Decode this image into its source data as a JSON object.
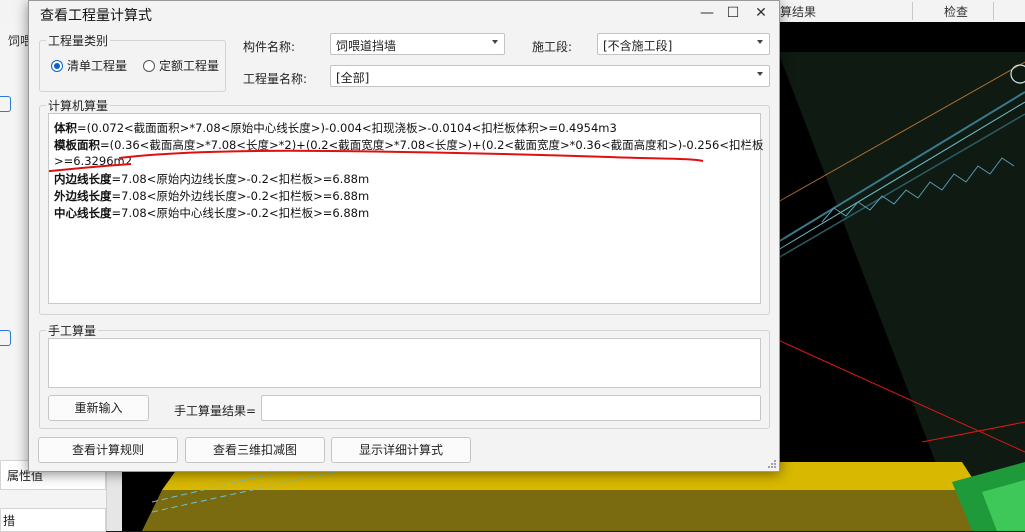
{
  "background_app": {
    "top_menu": [
      "算结果",
      "检查"
    ],
    "left_tab": "饲喂",
    "left_tab_short": "饲喂",
    "property_label": "属性值",
    "bottom_label": "措"
  },
  "dialog": {
    "title": "查看工程量计算式",
    "window_controls": {
      "minimize": "—",
      "maximize": "☐",
      "close": "✕"
    },
    "quantity_type": {
      "legend": "工程量类别",
      "options": [
        {
          "label": "清单工程量",
          "selected": true
        },
        {
          "label": "定额工程量",
          "selected": false
        }
      ]
    },
    "component_name": {
      "label": "构件名称:",
      "value": "饲喂道挡墙"
    },
    "construction_section": {
      "label": "施工段:",
      "value": "[不含施工段]"
    },
    "quantity_name": {
      "label": "工程量名称:",
      "value": "[全部]"
    },
    "computer_calc": {
      "legend": "计算机算量",
      "lines": [
        {
          "name": "体积",
          "expr": "=(0.072<截面面积>*7.08<原始中心线长度>)-0.004<扣现浇板>-0.0104<扣栏板体积>=0.4954m3"
        },
        {
          "name": "模板面积",
          "expr": "=(0.36<截面高度>*7.08<长度>*2)+(0.2<截面宽度>*7.08<长度>)+(0.2<截面宽度>*0.36<截面高度和>)-0.256<扣栏板"
        },
        {
          "name": "",
          "expr": ">=6.3296m2"
        },
        {
          "name": "内边线长度",
          "expr": "=7.08<原始内边线长度>-0.2<扣栏板>=6.88m"
        },
        {
          "name": "外边线长度",
          "expr": "=7.08<原始外边线长度>-0.2<扣栏板>=6.88m"
        },
        {
          "name": "中心线长度",
          "expr": "=7.08<原始中心线长度>-0.2<扣栏板>=6.88m"
        }
      ]
    },
    "manual_calc": {
      "legend": "手工算量",
      "reinput_button": "重新输入",
      "result_label": "手工算量结果=",
      "result_value": ""
    },
    "buttons": {
      "view_rules": "查看计算规则",
      "view_3d": "查看三维扣减图",
      "show_detail": "显示详细计算式"
    },
    "annotation_color": "#e01010"
  }
}
